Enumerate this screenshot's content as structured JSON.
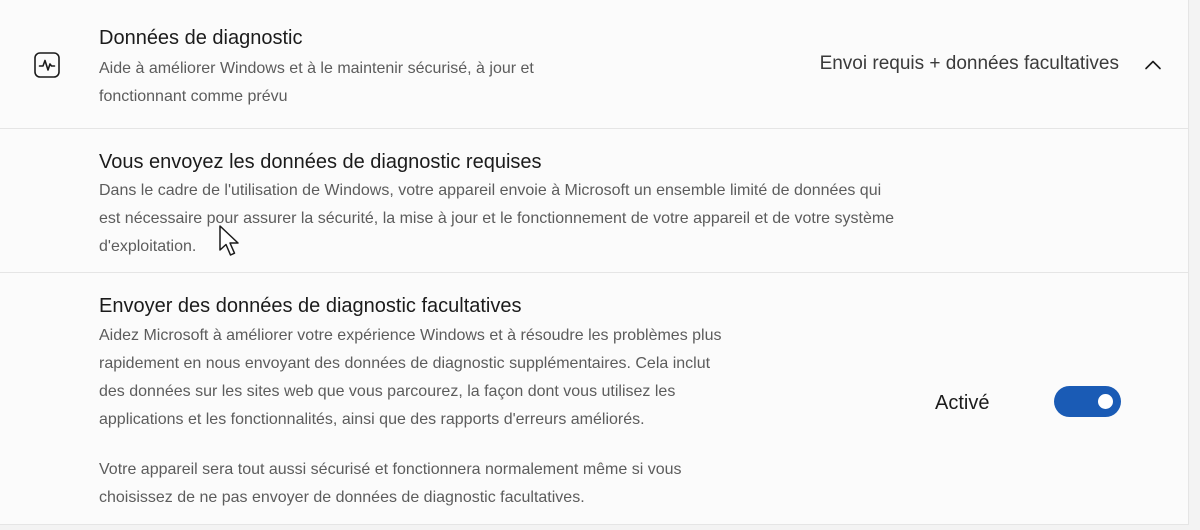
{
  "header": {
    "title": "Données de diagnostic",
    "description_line1": "Aide à améliorer Windows et à le maintenir sécurisé, à jour et",
    "description_line2": "fonctionnant comme prévu",
    "value": "Envoi requis + données facultatives",
    "icon": "activity-icon",
    "expand_icon": "chevron-up-icon"
  },
  "required_section": {
    "title": "Vous envoyez les données de diagnostic requises",
    "description_line1": "Dans le cadre de l'utilisation de Windows, votre appareil envoie à Microsoft un ensemble limité de données qui",
    "description_line2": "est nécessaire pour assurer la sécurité, la mise à jour et le fonctionnement de votre appareil et de votre système",
    "description_line3": "d'exploitation."
  },
  "optional_section": {
    "title": "Envoyer des données de diagnostic facultatives",
    "description_line1": "Aidez Microsoft à améliorer votre expérience Windows et à résoudre les problèmes plus",
    "description_line2": "rapidement en nous envoyant des données de diagnostic supplémentaires. Cela inclut",
    "description_line3": "des données sur les sites web que vous parcourez, la façon dont vous utilisez les",
    "description_line4": "applications et les fonctionnalités, ainsi que des rapports d'erreurs améliorés.",
    "note_line1": "Votre appareil sera tout aussi sécurisé et fonctionnera normalement même si vous",
    "note_line2": "choisissez de ne pas envoyer de données de diagnostic facultatives.",
    "toggle_label": "Activé",
    "toggle_on": true
  },
  "colors": {
    "accent": "#1a5bb5",
    "background": "#fbfbfb",
    "secondary_text": "#5c5c5c"
  }
}
